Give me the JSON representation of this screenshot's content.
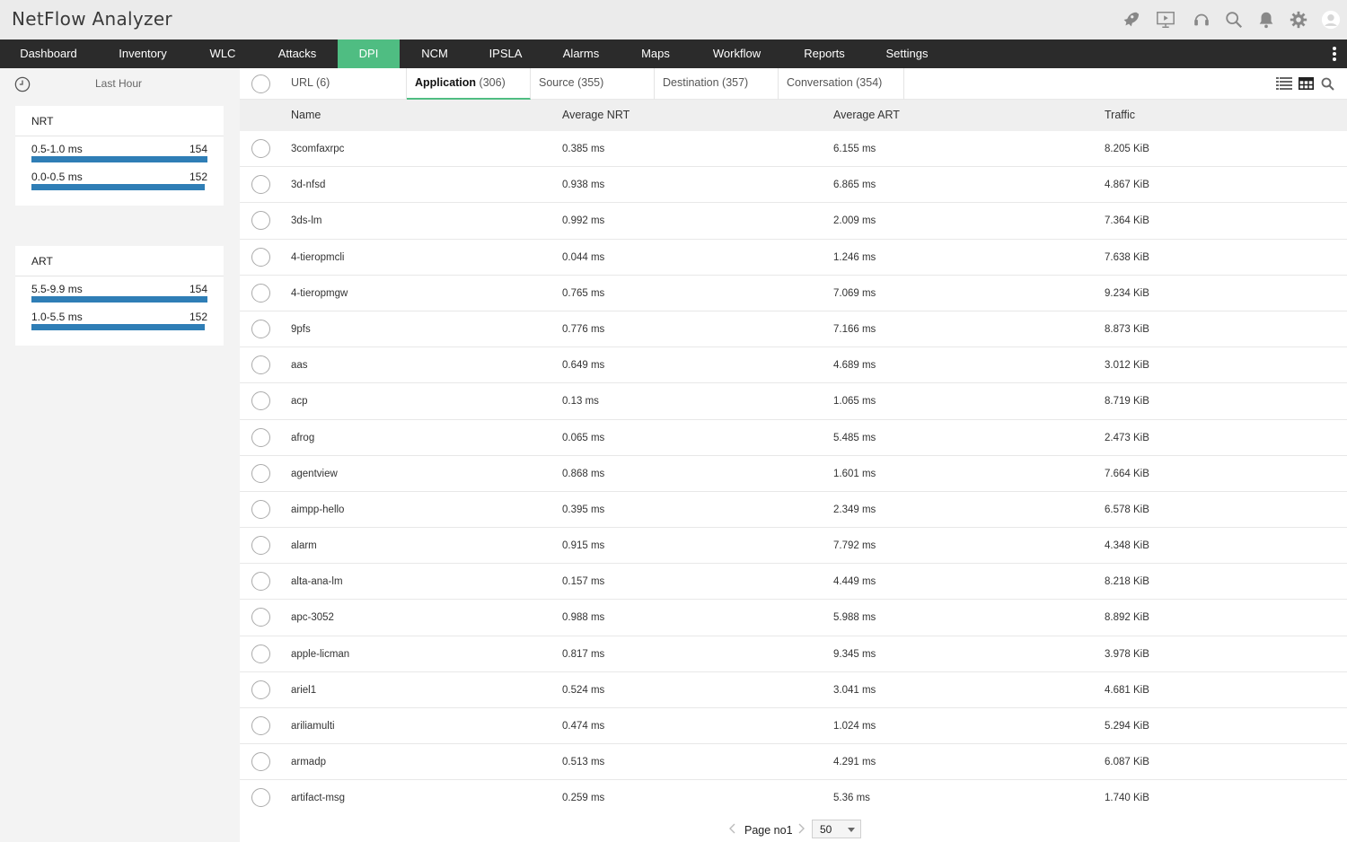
{
  "app": {
    "title": "NetFlow Analyzer"
  },
  "top_icons": [
    "rocket-icon",
    "presentation-icon",
    "headset-icon",
    "search-icon",
    "bell-icon",
    "gear-icon",
    "user-avatar-icon"
  ],
  "nav": {
    "items": [
      {
        "label": "Dashboard",
        "active": false
      },
      {
        "label": "Inventory",
        "active": false
      },
      {
        "label": "WLC",
        "active": false
      },
      {
        "label": "Attacks",
        "active": false
      },
      {
        "label": "DPI",
        "active": true
      },
      {
        "label": "NCM",
        "active": false
      },
      {
        "label": "IPSLA",
        "active": false
      },
      {
        "label": "Alarms",
        "active": false
      },
      {
        "label": "Maps",
        "active": false
      },
      {
        "label": "Workflow",
        "active": false
      },
      {
        "label": "Reports",
        "active": false
      },
      {
        "label": "Settings",
        "active": false
      }
    ],
    "active_color": "#4fbd82"
  },
  "sidebar": {
    "time_filter": "Last Hour",
    "nrt": {
      "title": "NRT",
      "buckets": [
        {
          "label": "0.5-1.0 ms",
          "count": "154",
          "fraction": 1.0
        },
        {
          "label": "0.0-0.5 ms",
          "count": "152",
          "fraction": 0.987
        }
      ]
    },
    "art": {
      "title": "ART",
      "buckets": [
        {
          "label": "5.5-9.9 ms",
          "count": "154",
          "fraction": 1.0
        },
        {
          "label": "1.0-5.5 ms",
          "count": "152",
          "fraction": 0.987
        }
      ]
    },
    "bar_color": "#2f7eb6"
  },
  "tabs": [
    {
      "label": "URL",
      "count": "(6)",
      "active": false
    },
    {
      "label": "Application",
      "count": "(306)",
      "active": true
    },
    {
      "label": "Source",
      "count": "(355)",
      "active": false
    },
    {
      "label": "Destination",
      "count": "(357)",
      "active": false
    },
    {
      "label": "Conversation",
      "count": "(354)",
      "active": false
    }
  ],
  "table": {
    "columns": [
      "Name",
      "Average NRT",
      "Average ART",
      "Traffic"
    ],
    "rows": [
      [
        "3comfaxrpc",
        "0.385 ms",
        "6.155 ms",
        "8.205 KiB"
      ],
      [
        "3d-nfsd",
        "0.938 ms",
        "6.865 ms",
        "4.867 KiB"
      ],
      [
        "3ds-lm",
        "0.992 ms",
        "2.009 ms",
        "7.364 KiB"
      ],
      [
        "4-tieropmcli",
        "0.044 ms",
        "1.246 ms",
        "7.638 KiB"
      ],
      [
        "4-tieropmgw",
        "0.765 ms",
        "7.069 ms",
        "9.234 KiB"
      ],
      [
        "9pfs",
        "0.776 ms",
        "7.166 ms",
        "8.873 KiB"
      ],
      [
        "aas",
        "0.649 ms",
        "4.689 ms",
        "3.012 KiB"
      ],
      [
        "acp",
        "0.13 ms",
        "1.065 ms",
        "8.719 KiB"
      ],
      [
        "afrog",
        "0.065 ms",
        "5.485 ms",
        "2.473 KiB"
      ],
      [
        "agentview",
        "0.868 ms",
        "1.601 ms",
        "7.664 KiB"
      ],
      [
        "aimpp-hello",
        "0.395 ms",
        "2.349 ms",
        "6.578 KiB"
      ],
      [
        "alarm",
        "0.915 ms",
        "7.792 ms",
        "4.348 KiB"
      ],
      [
        "alta-ana-lm",
        "0.157 ms",
        "4.449 ms",
        "8.218 KiB"
      ],
      [
        "apc-3052",
        "0.988 ms",
        "5.988 ms",
        "8.892 KiB"
      ],
      [
        "apple-licman",
        "0.817 ms",
        "9.345 ms",
        "3.978 KiB"
      ],
      [
        "ariel1",
        "0.524 ms",
        "3.041 ms",
        "4.681 KiB"
      ],
      [
        "ariliamulti",
        "0.474 ms",
        "1.024 ms",
        "5.294 KiB"
      ],
      [
        "armadp",
        "0.513 ms",
        "4.291 ms",
        "6.087 KiB"
      ],
      [
        "artifact-msg",
        "0.259 ms",
        "5.36 ms",
        "1.740 KiB"
      ]
    ]
  },
  "pager": {
    "page_label": "Page no1",
    "page_size": "50"
  }
}
